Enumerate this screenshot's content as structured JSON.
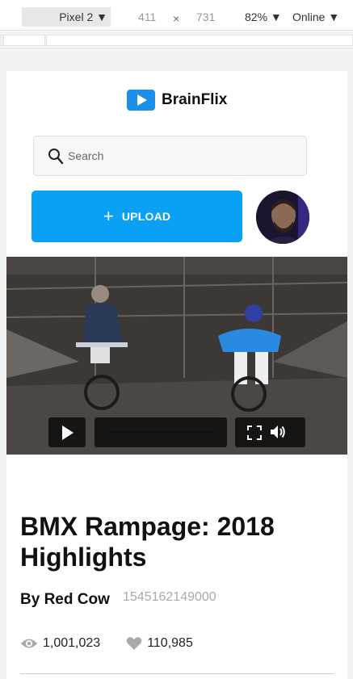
{
  "devtools": {
    "device": "Pixel 2",
    "width": "411",
    "times": "×",
    "height": "731",
    "zoom": "82%",
    "network": "Online"
  },
  "app": {
    "brand": "BrainFlix",
    "search": {
      "placeholder": "Search"
    },
    "upload_label": "UPLOAD",
    "upload_icon": "plus-icon"
  },
  "video": {
    "title": "BMX Rampage: 2018 Highlights",
    "author": "By Red Cow",
    "timestamp": "1545162149000",
    "views": "1,001,023",
    "likes": "110,985"
  },
  "colors": {
    "accent": "#0aa0f5",
    "logo": "#1a90e8"
  }
}
